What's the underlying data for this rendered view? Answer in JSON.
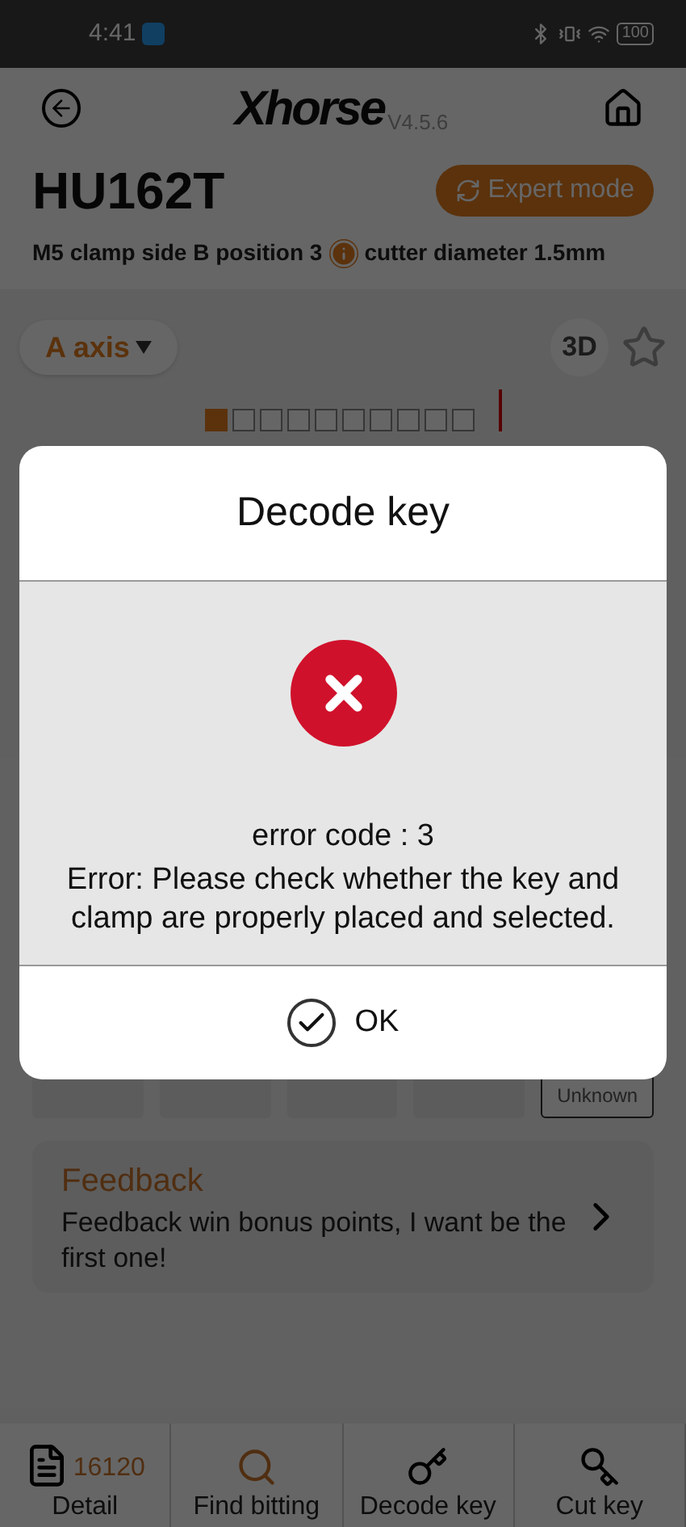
{
  "status_bar": {
    "time": "4:41",
    "battery": "100"
  },
  "header": {
    "logo": "Xhorse",
    "version": "V4.5.6"
  },
  "key": {
    "name": "HU162T",
    "expert_button": "Expert mode",
    "clamp_info": "M5 clamp side B position 3",
    "cutter": "cutter diameter 1.5mm"
  },
  "toolbar": {
    "axis": "A axis",
    "view_3d": "3D",
    "favorite": false
  },
  "cuts": [
    {
      "selected": true
    },
    {
      "selected": false
    },
    {
      "selected": false
    },
    {
      "selected": false
    },
    {
      "selected": false
    },
    {
      "selected": false
    },
    {
      "selected": false
    },
    {
      "selected": false
    },
    {
      "selected": false
    },
    {
      "selected": false
    }
  ],
  "depths": [
    {
      "kind": "empty"
    },
    {
      "kind": "empty"
    },
    {
      "kind": "empty"
    },
    {
      "kind": "empty"
    },
    {
      "kind": "label",
      "label": "Unknown"
    }
  ],
  "feedback": {
    "title": "Feedback",
    "text": "Feedback win bonus points, I want be the first one!"
  },
  "nav": [
    {
      "kind": "detail",
      "label": "Detail",
      "badge": "16120"
    },
    {
      "kind": "find",
      "label": "Find bitting"
    },
    {
      "kind": "decode",
      "label": "Decode key"
    },
    {
      "kind": "cut",
      "label": "Cut key"
    }
  ],
  "dialog": {
    "title": "Decode key",
    "error_code": "error code : 3",
    "message": "Error: Please check whether the key and clamp are properly placed and selected.",
    "ok": "OK"
  }
}
